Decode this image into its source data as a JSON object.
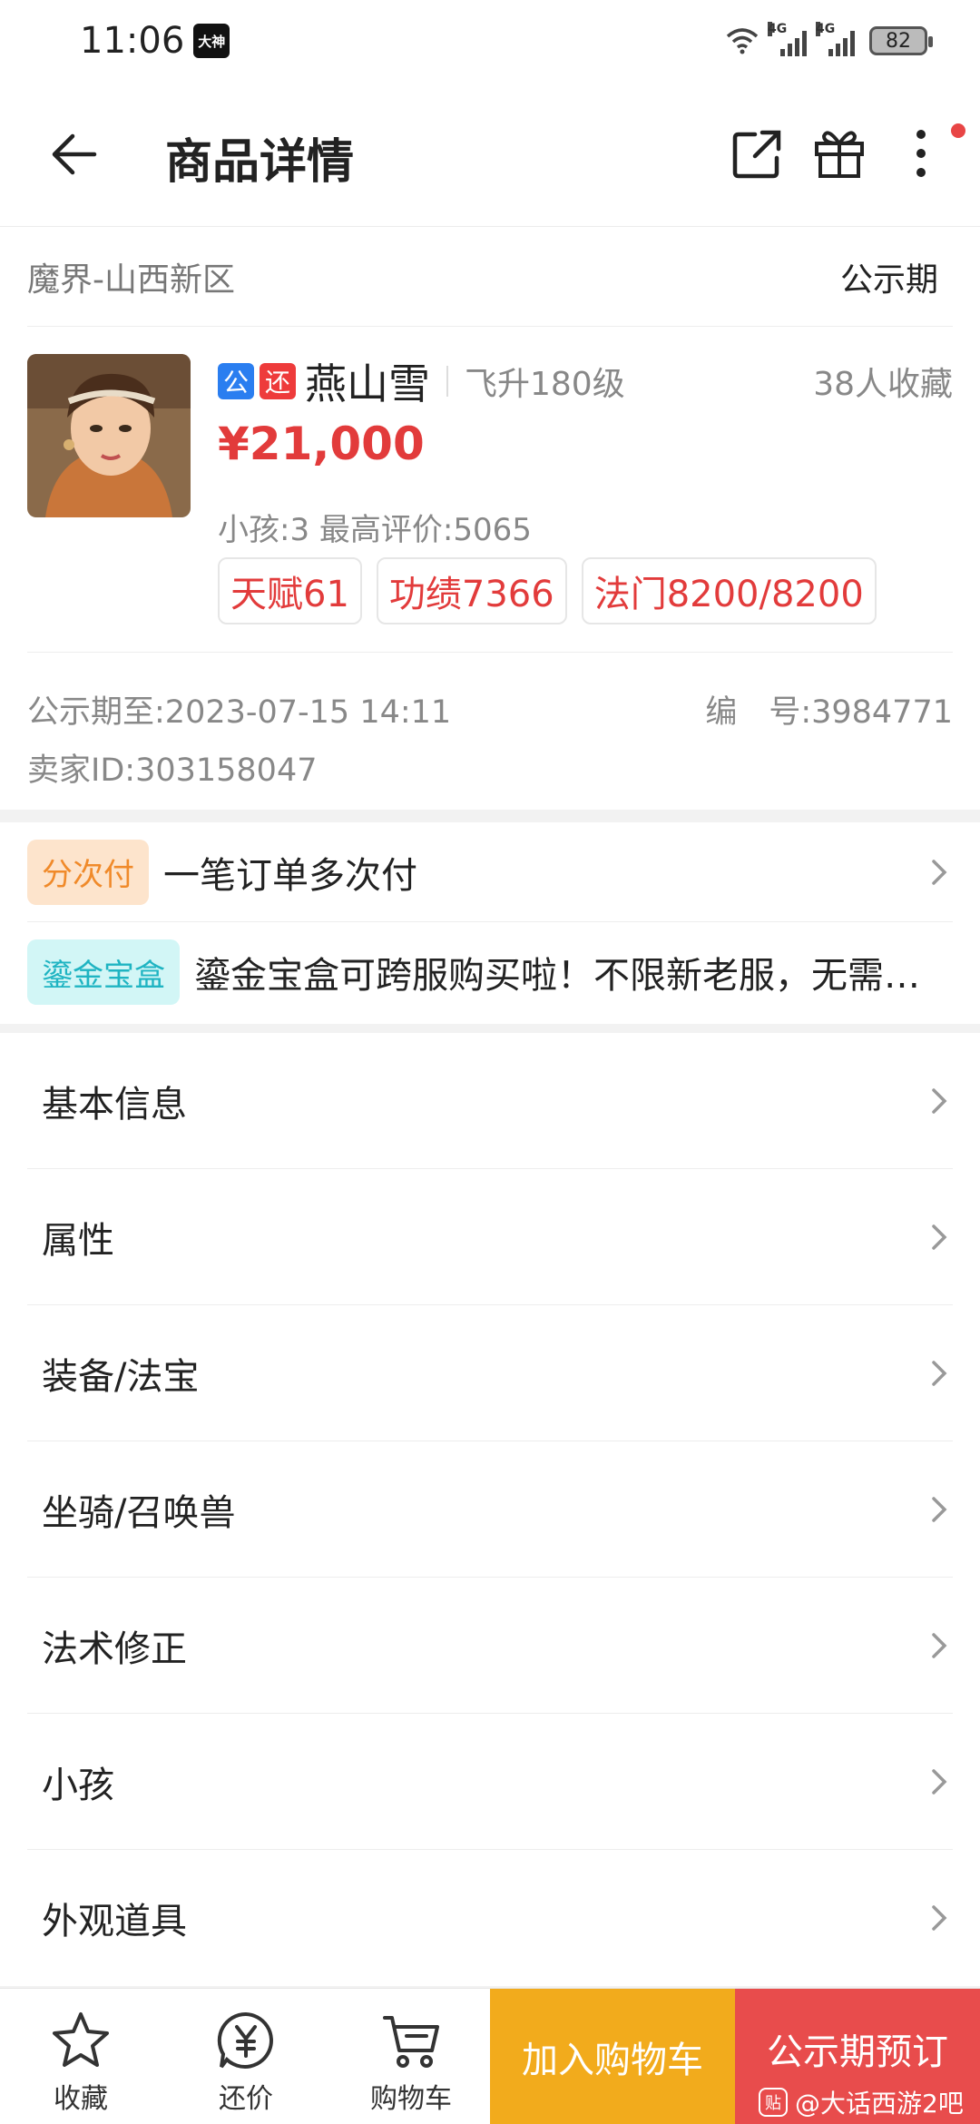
{
  "status_bar": {
    "time": "11:06",
    "app_badge": "大神",
    "net1": "4G",
    "net2": "4G",
    "battery": "82"
  },
  "header": {
    "title": "商品详情"
  },
  "item": {
    "server": "魔界-山西新区",
    "phase": "公示期",
    "tag_public": "公",
    "tag_return": "还",
    "name": "燕山雪",
    "level": "飞升180级",
    "favorites": "38人收藏",
    "price": "¥21,000",
    "meta": "小孩:3 最高评价:5065",
    "chips": [
      "天赋61",
      "功绩7366",
      "法门8200/8200"
    ],
    "public_until_label": "公示期至:",
    "public_until": "2023-07-15 14:11",
    "number_label": "编　号:",
    "number": "3984771",
    "seller_label": "卖家ID:",
    "seller_id": "303158047"
  },
  "promos": [
    {
      "badge": "分次付",
      "text": "一笔订单多次付"
    },
    {
      "badge": "鎏金宝盒",
      "text": "鎏金宝盒可跨服购买啦！不限新老服，无需…"
    }
  ],
  "menu": [
    "基本信息",
    "属性",
    "装备/法宝",
    "坐骑/召唤兽",
    "法术修正",
    "小孩",
    "外观道具"
  ],
  "bottom": {
    "favorite": "收藏",
    "bargain": "还价",
    "cart": "购物车",
    "add_to_cart": "加入购物车",
    "reserve": "公示期预订"
  },
  "watermark": {
    "logo": "贴",
    "text": "@大话西游2吧"
  },
  "colors": {
    "price_red": "#e23b3b",
    "cart_yellow": "#f2ab1c",
    "reserve_red": "#e84c4c"
  }
}
